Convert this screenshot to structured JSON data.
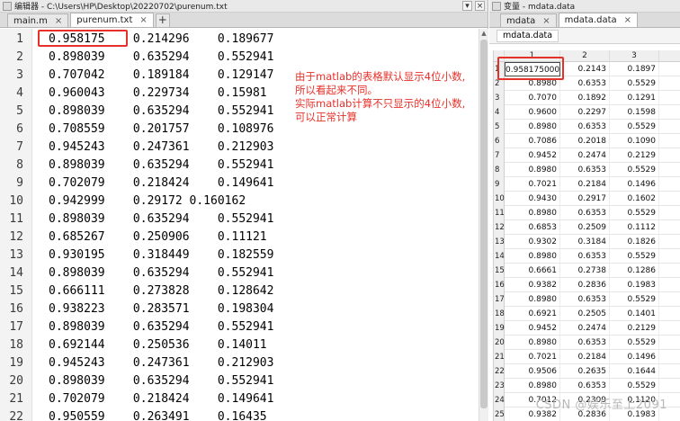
{
  "editor": {
    "title": "编辑器 - C:\\Users\\HP\\Desktop\\20220702\\purenum.txt",
    "tabs": [
      {
        "label": "main.m"
      },
      {
        "label": "purenum.txt"
      }
    ],
    "add_tab_label": "+",
    "lines": [
      {
        "n": "1",
        "text": "0.958175    0.214296    0.189677"
      },
      {
        "n": "2",
        "text": "0.898039    0.635294    0.552941"
      },
      {
        "n": "3",
        "text": "0.707042    0.189184    0.129147"
      },
      {
        "n": "4",
        "text": "0.960043    0.229734    0.15981"
      },
      {
        "n": "5",
        "text": "0.898039    0.635294    0.552941"
      },
      {
        "n": "6",
        "text": "0.708559    0.201757    0.108976"
      },
      {
        "n": "7",
        "text": "0.945243    0.247361    0.212903"
      },
      {
        "n": "8",
        "text": "0.898039    0.635294    0.552941"
      },
      {
        "n": "9",
        "text": "0.702079    0.218424    0.149641"
      },
      {
        "n": "10",
        "text": "0.942999    0.29172 0.160162"
      },
      {
        "n": "11",
        "text": "0.898039    0.635294    0.552941"
      },
      {
        "n": "12",
        "text": "0.685267    0.250906    0.11121"
      },
      {
        "n": "13",
        "text": "0.930195    0.318449    0.182559"
      },
      {
        "n": "14",
        "text": "0.898039    0.635294    0.552941"
      },
      {
        "n": "15",
        "text": "0.666111    0.273828    0.128642"
      },
      {
        "n": "16",
        "text": "0.938223    0.283571    0.198304"
      },
      {
        "n": "17",
        "text": "0.898039    0.635294    0.552941"
      },
      {
        "n": "18",
        "text": "0.692144    0.250536    0.14011"
      },
      {
        "n": "19",
        "text": "0.945243    0.247361    0.212903"
      },
      {
        "n": "20",
        "text": "0.898039    0.635294    0.552941"
      },
      {
        "n": "21",
        "text": "0.702079    0.218424    0.149641"
      },
      {
        "n": "22",
        "text": "0.950559    0.263491    0.16435"
      }
    ],
    "annotation": [
      "由于matlab的表格默认显示4位小数,",
      "所以看起来不同。",
      "实际matlab计算不只显示的4位小数,",
      "可以正常计算"
    ]
  },
  "variables": {
    "title": "变量 - mdata.data",
    "tabs": [
      {
        "label": "mdata"
      },
      {
        "label": "mdata.data"
      }
    ],
    "subtab": "mdata.data",
    "columns": [
      "1",
      "2",
      "3"
    ],
    "rows": [
      {
        "n": "1",
        "c1": "0.958175000",
        "c2": "0.2143",
        "c3": "0.1897"
      },
      {
        "n": "2",
        "c1": "0.8980",
        "c2": "0.6353",
        "c3": "0.5529"
      },
      {
        "n": "3",
        "c1": "0.7070",
        "c2": "0.1892",
        "c3": "0.1291"
      },
      {
        "n": "4",
        "c1": "0.9600",
        "c2": "0.2297",
        "c3": "0.1598"
      },
      {
        "n": "5",
        "c1": "0.8980",
        "c2": "0.6353",
        "c3": "0.5529"
      },
      {
        "n": "6",
        "c1": "0.7086",
        "c2": "0.2018",
        "c3": "0.1090"
      },
      {
        "n": "7",
        "c1": "0.9452",
        "c2": "0.2474",
        "c3": "0.2129"
      },
      {
        "n": "8",
        "c1": "0.8980",
        "c2": "0.6353",
        "c3": "0.5529"
      },
      {
        "n": "9",
        "c1": "0.7021",
        "c2": "0.2184",
        "c3": "0.1496"
      },
      {
        "n": "10",
        "c1": "0.9430",
        "c2": "0.2917",
        "c3": "0.1602"
      },
      {
        "n": "11",
        "c1": "0.8980",
        "c2": "0.6353",
        "c3": "0.5529"
      },
      {
        "n": "12",
        "c1": "0.6853",
        "c2": "0.2509",
        "c3": "0.1112"
      },
      {
        "n": "13",
        "c1": "0.9302",
        "c2": "0.3184",
        "c3": "0.1826"
      },
      {
        "n": "14",
        "c1": "0.8980",
        "c2": "0.6353",
        "c3": "0.5529"
      },
      {
        "n": "15",
        "c1": "0.6661",
        "c2": "0.2738",
        "c3": "0.1286"
      },
      {
        "n": "16",
        "c1": "0.9382",
        "c2": "0.2836",
        "c3": "0.1983"
      },
      {
        "n": "17",
        "c1": "0.8980",
        "c2": "0.6353",
        "c3": "0.5529"
      },
      {
        "n": "18",
        "c1": "0.6921",
        "c2": "0.2505",
        "c3": "0.1401"
      },
      {
        "n": "19",
        "c1": "0.9452",
        "c2": "0.2474",
        "c3": "0.2129"
      },
      {
        "n": "20",
        "c1": "0.8980",
        "c2": "0.6353",
        "c3": "0.5529"
      },
      {
        "n": "21",
        "c1": "0.7021",
        "c2": "0.2184",
        "c3": "0.1496"
      },
      {
        "n": "22",
        "c1": "0.9506",
        "c2": "0.2635",
        "c3": "0.1644"
      },
      {
        "n": "23",
        "c1": "0.8980",
        "c2": "0.6353",
        "c3": "0.5529"
      },
      {
        "n": "24",
        "c1": "0.7012",
        "c2": "0.2309",
        "c3": "0.1120"
      },
      {
        "n": "25",
        "c1": "0.9382",
        "c2": "0.2836",
        "c3": "0.1983"
      }
    ]
  },
  "watermark": "CSDN @娱乐至上2091",
  "colors": {
    "annotation": "#e8302a",
    "highlight": "#e8302a"
  }
}
